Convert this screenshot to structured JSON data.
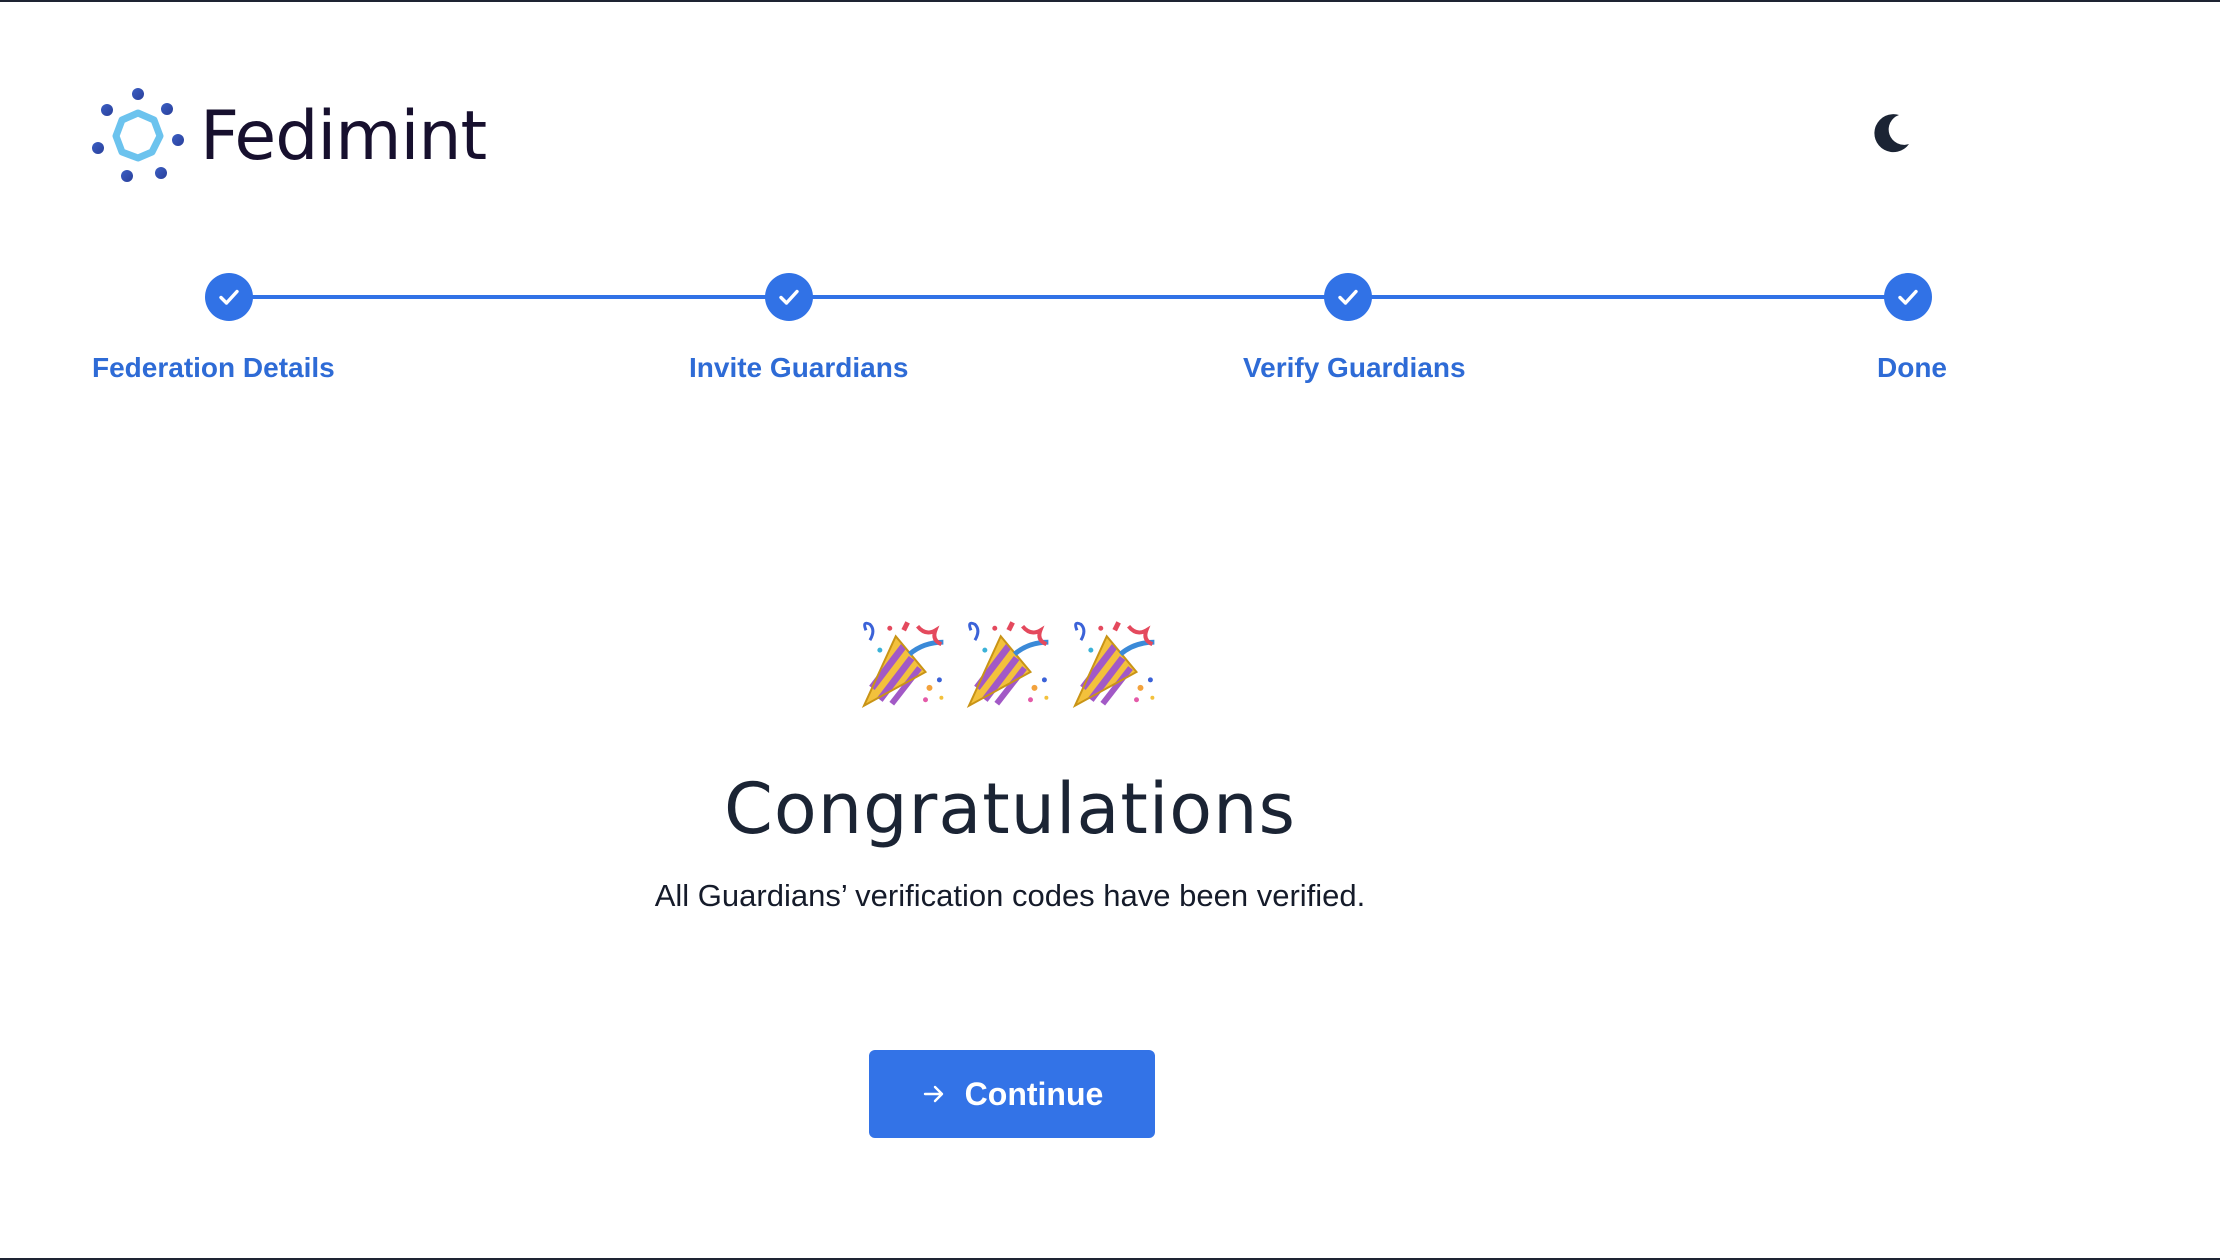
{
  "app": {
    "brand_name": "Fedimint"
  },
  "icons": {
    "logo": "fedimint-logo-icon",
    "theme_toggle": "moon-icon",
    "step_complete": "checkmark-icon",
    "celebration": "party-popper-icon",
    "continue": "arrow-right-icon"
  },
  "colors": {
    "accent": "#3172e6",
    "step_label": "#2e6bd6",
    "heading": "#1b2434",
    "brand_text": "#17102e"
  },
  "stepper": {
    "steps": [
      {
        "label": "Federation Details",
        "status": "complete"
      },
      {
        "label": "Invite Guardians",
        "status": "complete"
      },
      {
        "label": "Verify Guardians",
        "status": "complete"
      },
      {
        "label": "Done",
        "status": "complete"
      }
    ]
  },
  "content": {
    "title": "Congratulations",
    "message": "All Guardians’ verification codes have been verified.",
    "continue_label": "Continue"
  }
}
